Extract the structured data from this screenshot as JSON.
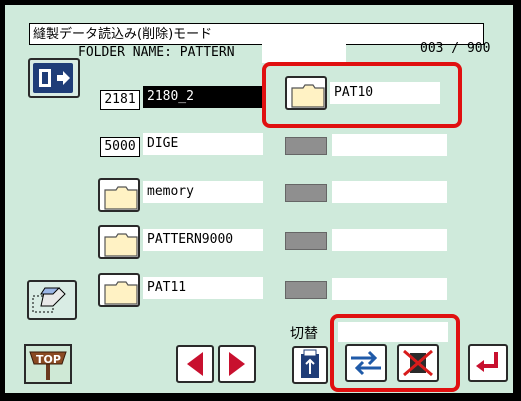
{
  "title": "縫製データ読込み(削除)モード",
  "page_counter": "003 / 900",
  "folder_name_label": "FOLDER NAME: PATTERN",
  "rows": [
    {
      "id": "2181",
      "name": "2180_2",
      "selected": true
    },
    {
      "id": "5000",
      "name": "DIGE"
    },
    {
      "name": "memory"
    },
    {
      "name": "PATTERN9000"
    },
    {
      "name": "PAT11"
    }
  ],
  "right_rows": [
    {
      "name": "PAT10"
    }
  ],
  "kirikae_label": "切替",
  "buttons": {
    "top_label": "TOP"
  },
  "colors": {
    "background": "#cfeadb",
    "highlight": "#e01010",
    "accent_blue": "#1f5aa8",
    "nav_red": "#c8102e"
  }
}
